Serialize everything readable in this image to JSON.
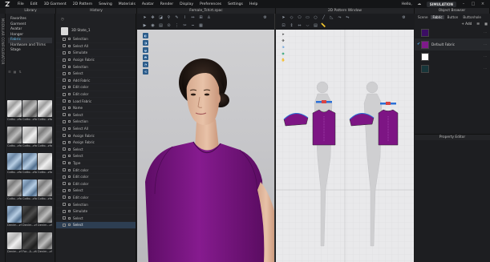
{
  "menu": [
    "File",
    "Edit",
    "3D Garment",
    "2D Pattern",
    "Sewing",
    "Materials",
    "Avatar",
    "Render",
    "Display",
    "Preferences",
    "Settings",
    "Help"
  ],
  "user": {
    "greeting": "Hello,",
    "mode": "SIMULATION"
  },
  "panels": {
    "library": "Library",
    "history": "History",
    "viewport3d": "Female_Tshirt.zpac",
    "viewport2d": "2D Pattern Window",
    "object_browser": "Object Browser",
    "property_editor": "Property Editor"
  },
  "vertical_tab": "MODULAR CONFIGURATOR",
  "library_items": [
    {
      "label": "Favorites",
      "state": "normal"
    },
    {
      "label": "Garment",
      "state": "normal"
    },
    {
      "label": "Avatar",
      "state": "normal"
    },
    {
      "label": "Hanger",
      "state": "normal"
    },
    {
      "label": "Fabric",
      "state": "active"
    },
    {
      "label": "Hardware and Trims",
      "state": "normal"
    },
    {
      "label": "Stage",
      "state": "normal"
    }
  ],
  "library_tools": [
    "☰",
    "▦",
    "⇅"
  ],
  "fabric_thumbs": [
    {
      "label": "Cotto...zfab",
      "tone": "t-white"
    },
    {
      "label": "Cotto...zfab",
      "tone": "t-grey"
    },
    {
      "label": "Cotto...zfab",
      "tone": "t-white"
    },
    {
      "label": "Cotto...zfab",
      "tone": "t-grey"
    },
    {
      "label": "Cotto...zfab",
      "tone": "t-light"
    },
    {
      "label": "Cotto...zfab",
      "tone": "t-grey"
    },
    {
      "label": "Cotto...zfab",
      "tone": "t-blue"
    },
    {
      "label": "Cotto...zfab",
      "tone": "t-blue"
    },
    {
      "label": "Cotto...zfab",
      "tone": "t-light"
    },
    {
      "label": "Cotto...zfab",
      "tone": "t-grey"
    },
    {
      "label": "Cotto...zfab",
      "tone": "t-blue"
    },
    {
      "label": "Cotto...zfab",
      "tone": "t-grey"
    },
    {
      "label": "Denim...zfab",
      "tone": "t-blue"
    },
    {
      "label": "Denim...zfab",
      "tone": "t-dark"
    },
    {
      "label": "Denim...zfab",
      "tone": "t-grey"
    },
    {
      "label": "Denim...zfab",
      "tone": "t-light"
    },
    {
      "label": "For...A...zfab",
      "tone": "t-dark"
    },
    {
      "label": "Denim...zfab",
      "tone": "t-grey"
    }
  ],
  "history_first": "3D State_1",
  "history_items": [
    {
      "label": "Selection",
      "sel": false
    },
    {
      "label": "Select All",
      "sel": false
    },
    {
      "label": "Simulate",
      "sel": false
    },
    {
      "label": "Assign Fabric",
      "sel": false
    },
    {
      "label": "Selection",
      "sel": false
    },
    {
      "label": "Select",
      "sel": false
    },
    {
      "label": "Add Fabric",
      "sel": false
    },
    {
      "label": "Edit color",
      "sel": false
    },
    {
      "label": "Edit color",
      "sel": false
    },
    {
      "label": "Load Fabric",
      "sel": false
    },
    {
      "label": "Name",
      "sel": false
    },
    {
      "label": "Select",
      "sel": false
    },
    {
      "label": "Selection",
      "sel": false
    },
    {
      "label": "Select All",
      "sel": false
    },
    {
      "label": "Assign Fabric",
      "sel": false
    },
    {
      "label": "Assign Fabric",
      "sel": false
    },
    {
      "label": "Select",
      "sel": false
    },
    {
      "label": "Select",
      "sel": false
    },
    {
      "label": "Type",
      "sel": false
    },
    {
      "label": "Edit color",
      "sel": false
    },
    {
      "label": "Edit color",
      "sel": false
    },
    {
      "label": "Edit color",
      "sel": false
    },
    {
      "label": "Select",
      "sel": false
    },
    {
      "label": "Edit color",
      "sel": false
    },
    {
      "label": "Selection",
      "sel": false
    },
    {
      "label": "Simulate",
      "sel": false
    },
    {
      "label": "Select",
      "sel": false
    },
    {
      "label": "Select",
      "sel": true
    }
  ],
  "object_tabs": [
    {
      "label": "Scene",
      "active": false
    },
    {
      "label": "Fabric",
      "active": true
    },
    {
      "label": "Button",
      "active": false
    },
    {
      "label": "Buttonhole",
      "active": false
    }
  ],
  "object_actions": [
    "+ Add",
    "☰",
    "▦"
  ],
  "fabrics": [
    {
      "name": "",
      "color": "#3b0d63",
      "checked": false,
      "sel": false
    },
    {
      "name": "Default Fabric",
      "color": "#7e1a8a",
      "checked": true,
      "sel": true
    },
    {
      "name": "",
      "color": "#ffffff",
      "checked": false,
      "sel": false
    },
    {
      "name": "",
      "color": "#17363a",
      "checked": false,
      "sel": false
    }
  ],
  "colors": {
    "garment": "#7d1584",
    "accent": "#4aa8e6",
    "selection": "#2d3e52"
  },
  "icons": [
    "folder-icon",
    "save-icon",
    "undo-icon",
    "redo-icon",
    "select-icon",
    "transform-icon",
    "fold-icon",
    "pin-icon"
  ]
}
